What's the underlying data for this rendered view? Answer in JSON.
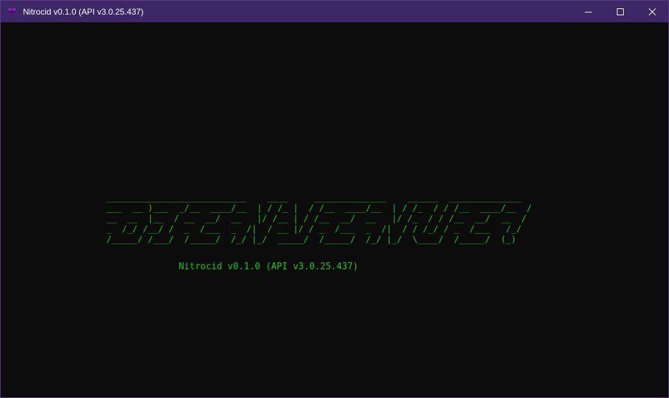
{
  "window": {
    "title": "Nitrocid v0.1.0 (API v3.0.25.437)",
    "controls": {
      "minimize": "minimize",
      "maximize": "maximize",
      "close": "close"
    },
    "colors": {
      "titlebar": "#3e2766",
      "border": "#5a3d86",
      "background": "#0c0c0c",
      "text_accent": "#22c222"
    },
    "icon": "nitrocid-diamond-icon"
  },
  "terminal": {
    "banner_lines": [
      "___________________________    ____     ______________    ______  ______________",
      "___  __ )___  _/__  ____/__  | / /_ |  / /__  ____/__  | / /_  / / /__  ____/__  /",
      "__  __  |__  / __  __/  __   |/ /__ | / /__  __/  __   |/ /_  / / /__  __/  __  / ",
      "_  /_/ /__/ /  _  /___  _  /|  / __ |/ / _  /___  _  /|  / / /_/ / _  /___   /_/  ",
      "/_____/ /___/  /_____/  /_/ |_/  _____/  /_____/  /_/ |_/  \\____/  /_____/  (_)   "
    ],
    "version_line": "Nitrocid v0.1.0 (API v3.0.25.437)"
  }
}
